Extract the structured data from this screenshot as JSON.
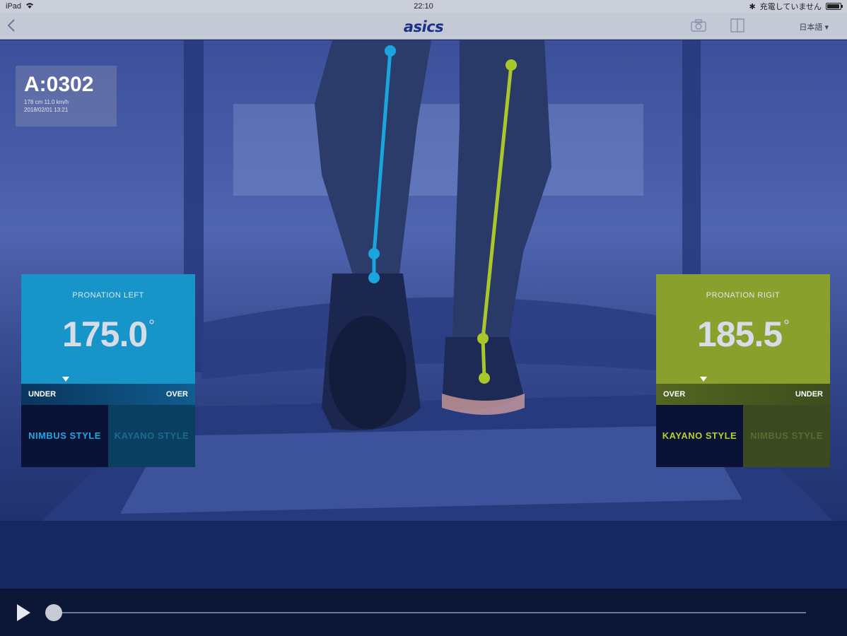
{
  "status_bar": {
    "device": "iPad",
    "time": "22:10",
    "charging_text": "充電していません"
  },
  "nav": {
    "back_icon": "chevron-left-icon",
    "brand": "asics",
    "camera_icon": "camera-icon",
    "compare_icon": "split-view-icon",
    "language": "日本語 ▾"
  },
  "runner_info": {
    "id": "A:0302",
    "stats": "178 cm  11.0 km/h",
    "datetime": "2018/02/01 13:21"
  },
  "pronation_left": {
    "title": "PRONATION LEFT",
    "value": "175.0",
    "unit": "°",
    "scale_left": "UNDER",
    "scale_right": "OVER",
    "style_selected": "NIMBUS STYLE",
    "style_other": "KAYANO STYLE",
    "accent": "#1795c8"
  },
  "pronation_right": {
    "title": "PRONATION RIGIT",
    "value": "185.5",
    "unit": "°",
    "scale_left": "OVER",
    "scale_right": "UNDER",
    "style_selected": "KAYANO STYLE",
    "style_other": "NIMBUS STYLE",
    "accent": "#8aa02c"
  },
  "playback": {
    "play_icon": "play-icon",
    "progress": 0
  }
}
